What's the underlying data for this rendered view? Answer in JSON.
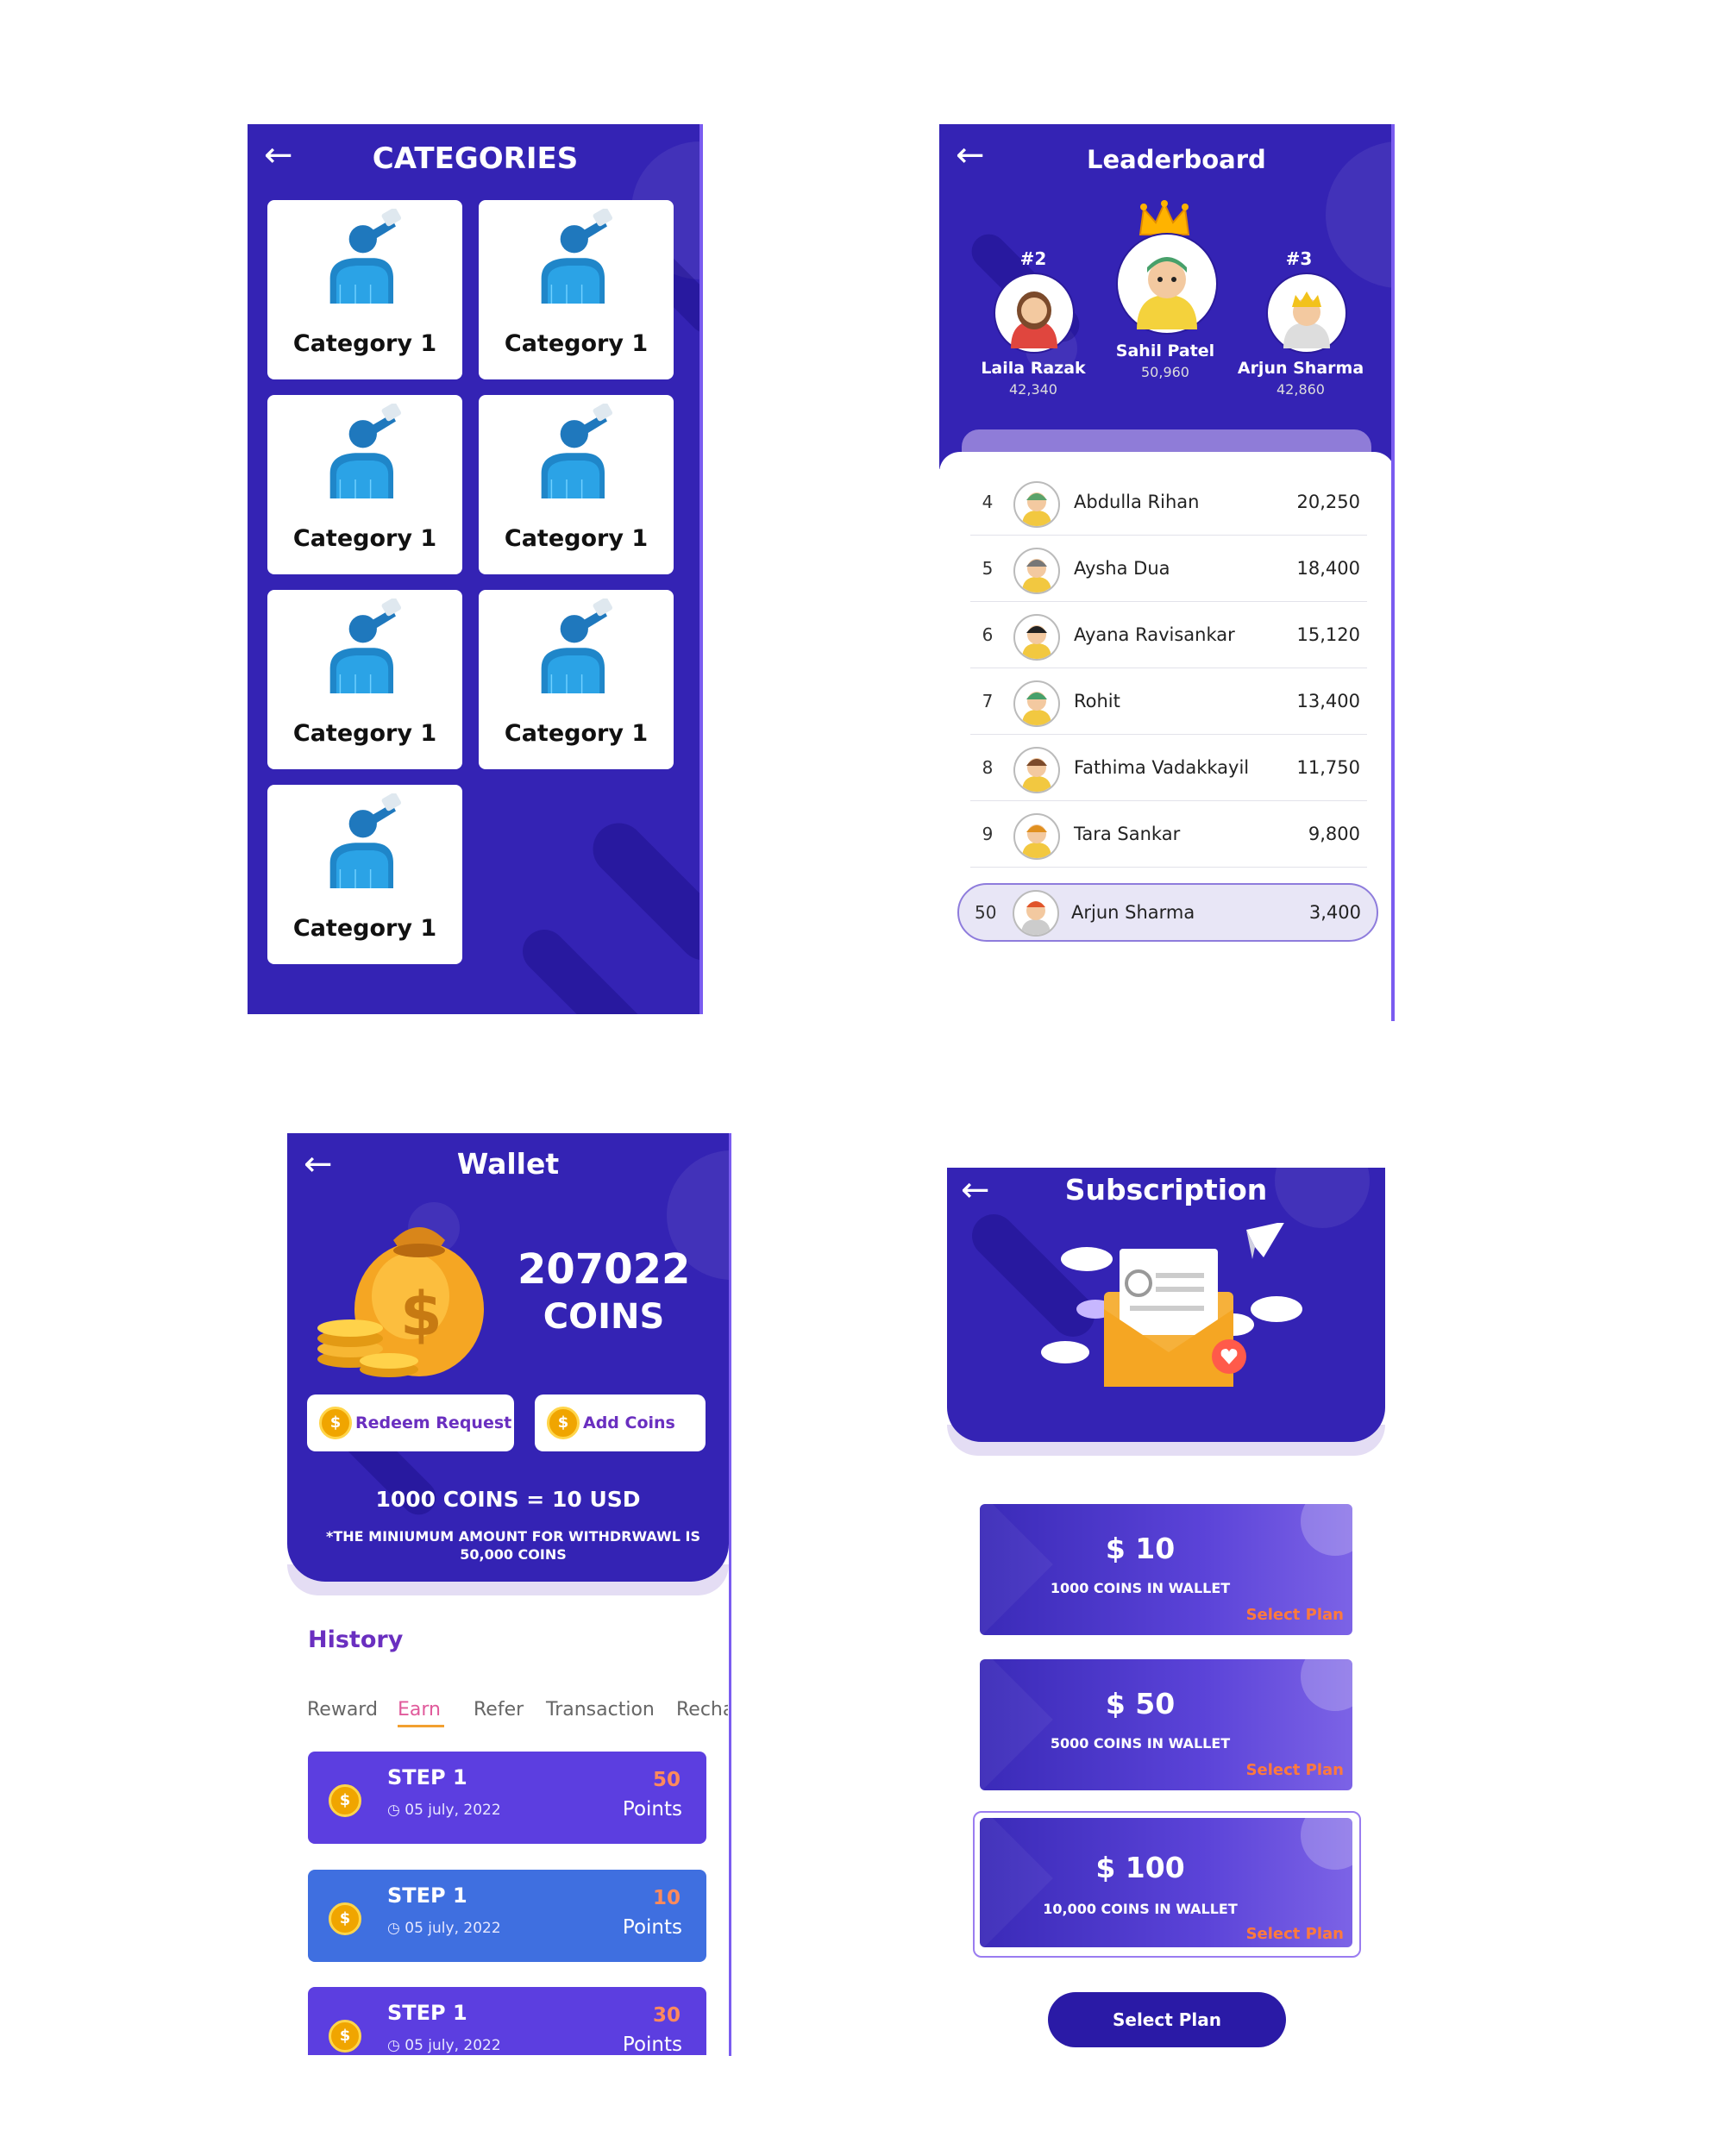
{
  "colors": {
    "primary": "#3423b4",
    "accent": "#6a2fc0",
    "orange": "#ff7a3c",
    "earn_tab": "#e05a9b"
  },
  "categories": {
    "title": "CATEGORIES",
    "back_icon": "arrow-left-icon",
    "items": [
      "Category 1",
      "Category 1",
      "Category 1",
      "Category 1",
      "Category 1",
      "Category 1",
      "Category 1"
    ]
  },
  "leaderboard": {
    "title": "Leaderboard",
    "podium": [
      {
        "rank": "#2",
        "name": "Laila Razak",
        "score": "42,340"
      },
      {
        "rank": "",
        "name": "Sahil Patel",
        "score": "50,960"
      },
      {
        "rank": "#3",
        "name": "Arjun Sharma",
        "score": "42,860"
      }
    ],
    "rows": [
      {
        "rank": "4",
        "name": "Abdulla Rihan",
        "score": "20,250"
      },
      {
        "rank": "5",
        "name": "Aysha Dua",
        "score": "18,400"
      },
      {
        "rank": "6",
        "name": "Ayana Ravisankar",
        "score": "15,120"
      },
      {
        "rank": "7",
        "name": "Rohit",
        "score": "13,400"
      },
      {
        "rank": "8",
        "name": "Fathima Vadakkayil",
        "score": "11,750"
      },
      {
        "rank": "9",
        "name": "Tara Sankar",
        "score": "9,800"
      }
    ],
    "current_user": {
      "rank": "50",
      "name": "Arjun Sharma",
      "score": "3,400"
    }
  },
  "wallet": {
    "title": "Wallet",
    "balance": "207022",
    "unit": "COINS",
    "redeem_label": "Redeem Request",
    "add_label": "Add Coins",
    "rate": "1000 COINS = 10 USD",
    "note_line1": "*THE MINIUMUM AMOUNT FOR WITHDRWAWL IS",
    "note_line2": "50,000 COINS",
    "history_title": "History",
    "tabs": [
      "Reward",
      "Earn",
      "Refer",
      "Transaction",
      "Recha"
    ],
    "active_tab": "Earn",
    "entries": [
      {
        "step": "STEP 1",
        "date": "05 july, 2022",
        "points": "50",
        "points_label": "Points"
      },
      {
        "step": "STEP 1",
        "date": "05 july, 2022",
        "points": "10",
        "points_label": "Points"
      },
      {
        "step": "STEP 1",
        "date": "05 july, 2022",
        "points": "30",
        "points_label": "Points"
      }
    ]
  },
  "subscription": {
    "title": "Subscription",
    "plans": [
      {
        "price": "$ 10",
        "desc": "1000 COINS IN WALLET",
        "action": "Select Plan"
      },
      {
        "price": "$ 50",
        "desc": "5000 COINS IN WALLET",
        "action": "Select Plan"
      },
      {
        "price": "$ 100",
        "desc": "10,000 COINS IN WALLET",
        "action": "Select Plan"
      }
    ],
    "select_button": "Select Plan"
  }
}
